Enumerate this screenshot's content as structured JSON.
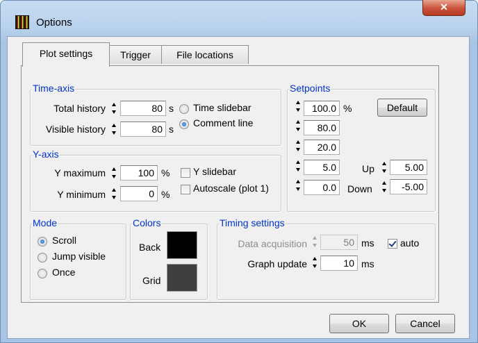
{
  "window": {
    "title": "Options",
    "close_glyph": "✕"
  },
  "tabs": [
    {
      "label": "Plot settings",
      "active": true
    },
    {
      "label": "Trigger",
      "active": false
    },
    {
      "label": "File locations",
      "active": false
    }
  ],
  "time_axis": {
    "legend": "Time-axis",
    "total_history": {
      "label": "Total history",
      "value": "80",
      "unit": "s"
    },
    "visible_history": {
      "label": "Visible history",
      "value": "80",
      "unit": "s"
    },
    "time_slidebar": {
      "label": "Time slidebar",
      "selected": false
    },
    "comment_line": {
      "label": "Comment line",
      "selected": true
    }
  },
  "y_axis": {
    "legend": "Y-axis",
    "y_maximum": {
      "label": "Y maximum",
      "value": "100",
      "unit": "%"
    },
    "y_minimum": {
      "label": "Y minimum",
      "value": "0",
      "unit": "%"
    },
    "y_slidebar": {
      "label": "Y slidebar",
      "checked": false
    },
    "autoscale": {
      "label": "Autoscale (plot 1)",
      "checked": false
    }
  },
  "setpoints": {
    "legend": "Setpoints",
    "values": [
      "100.0",
      "80.0",
      "20.0",
      "5.0",
      "0.0"
    ],
    "unit": "%",
    "default_label": "Default",
    "up": {
      "label": "Up",
      "value": "5.00"
    },
    "down": {
      "label": "Down",
      "value": "-5.00"
    }
  },
  "mode": {
    "legend": "Mode",
    "options": [
      {
        "label": "Scroll",
        "selected": true
      },
      {
        "label": "Jump visible",
        "selected": false
      },
      {
        "label": "Once",
        "selected": false
      }
    ]
  },
  "colors": {
    "legend": "Colors",
    "back": {
      "label": "Back",
      "color": "#000000"
    },
    "grid": {
      "label": "Grid",
      "color": "#3f3f3f"
    }
  },
  "timing": {
    "legend": "Timing settings",
    "data_acquisition": {
      "label": "Data acquisition",
      "value": "50",
      "unit": "ms",
      "enabled": false
    },
    "auto": {
      "label": "auto",
      "checked": true
    },
    "graph_update": {
      "label": "Graph update",
      "value": "10",
      "unit": "ms"
    }
  },
  "buttons": {
    "ok": "OK",
    "cancel": "Cancel"
  },
  "accent_color": "#0033cc"
}
